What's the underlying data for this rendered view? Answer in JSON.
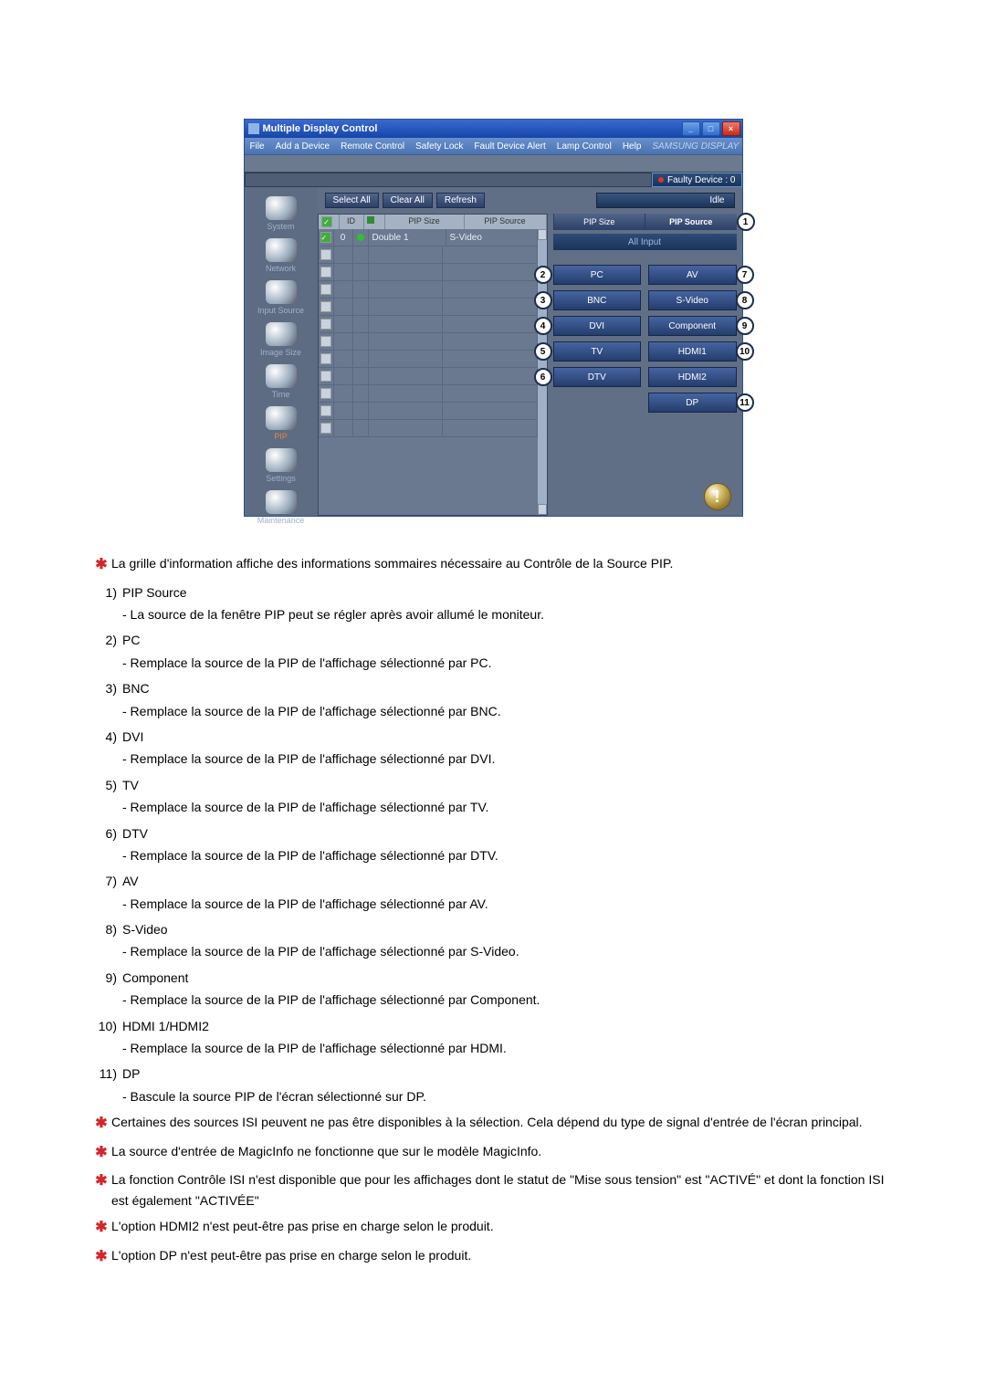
{
  "window": {
    "title": "Multiple Display Control",
    "menu": {
      "file": "File",
      "add_device": "Add a Device",
      "remote_control": "Remote Control",
      "safety_lock": "Safety Lock",
      "fault_alert": "Fault Device Alert",
      "lamp_control": "Lamp Control",
      "help": "Help",
      "brand": "SAMSUNG DISPLAY"
    },
    "status": {
      "faulty_device": "Faulty Device : 0"
    },
    "buttons": {
      "select_all": "Select All",
      "clear_all": "Clear All",
      "refresh": "Refresh",
      "idle": "Idle"
    },
    "sidebar": [
      {
        "label": "System"
      },
      {
        "label": "Network"
      },
      {
        "label": "Input Source"
      },
      {
        "label": "Image Size"
      },
      {
        "label": "Time"
      },
      {
        "label": "PIP"
      },
      {
        "label": "Settings"
      },
      {
        "label": "Maintenance"
      }
    ],
    "grid": {
      "headers": {
        "chk": "✓",
        "id": "ID",
        "status": "",
        "size": "PIP Size",
        "source": "PIP Source"
      },
      "row0": {
        "id": "0",
        "size": "Double 1",
        "source": "S-Video"
      }
    },
    "right_panel": {
      "tab_size": "PIP Size",
      "tab_source": "PIP Source",
      "all_input": "All Input",
      "buttons": {
        "pc": "PC",
        "av": "AV",
        "bnc": "BNC",
        "svideo": "S-Video",
        "dvi": "DVI",
        "component": "Component",
        "tv": "TV",
        "hdmi1": "HDMI1",
        "dtv": "DTV",
        "hdmi2": "HDMI2",
        "dp": "DP"
      }
    }
  },
  "explain": {
    "intro": "La grille d'information affiche des informations sommaires nécessaire au Contrôle de la Source PIP.",
    "items": [
      {
        "num": "1)",
        "title": "PIP Source",
        "desc": "- La source de la fenêtre PIP peut se régler après avoir allumé le moniteur."
      },
      {
        "num": "2)",
        "title": "PC",
        "desc": "- Remplace la source de la PIP de l'affichage sélectionné par PC."
      },
      {
        "num": "3)",
        "title": "BNC",
        "desc": "- Remplace la source de la PIP de l'affichage sélectionné par BNC."
      },
      {
        "num": "4)",
        "title": "DVI",
        "desc": "- Remplace la source de la PIP de l'affichage sélectionné par DVI."
      },
      {
        "num": "5)",
        "title": "TV",
        "desc": "- Remplace la source de la PIP de l'affichage sélectionné par TV."
      },
      {
        "num": "6)",
        "title": "DTV",
        "desc": "- Remplace la source de la PIP de l'affichage sélectionné par DTV."
      },
      {
        "num": "7)",
        "title": "AV",
        "desc": "- Remplace la source de la PIP de l'affichage sélectionné par AV."
      },
      {
        "num": "8)",
        "title": "S-Video",
        "desc": "- Remplace la source de la PIP de l'affichage sélectionné par S-Video."
      },
      {
        "num": "9)",
        "title": "Component",
        "desc": "- Remplace la source de la PIP de l'affichage sélectionné par Component."
      },
      {
        "num": "10)",
        "title": "HDMI 1/HDMI2",
        "desc": "- Remplace la source de la PIP de l'affichage sélectionné par HDMI."
      },
      {
        "num": "11)",
        "title": "DP",
        "desc": "- Bascule la source PIP de l'écran sélectionné sur DP."
      }
    ],
    "notes": [
      "Certaines des sources ISI peuvent ne pas être disponibles à la sélection. Cela dépend du type de signal d'entrée de l'écran principal.",
      "La source d'entrée de MagicInfo ne fonctionne que sur le modèle MagicInfo.",
      "La fonction Contrôle ISI n'est disponible que pour les affichages dont le statut de \"Mise sous tension\" est \"ACTIVÉ\" et dont la fonction ISI est également \"ACTIVÉE\"",
      "L'option HDMI2 n'est peut-être pas prise en charge selon le produit.",
      "L'option DP n'est peut-être pas prise en charge selon le produit."
    ]
  },
  "callouts": {
    "c1": "1",
    "c2": "2",
    "c3": "3",
    "c4": "4",
    "c5": "5",
    "c6": "6",
    "c7": "7",
    "c8": "8",
    "c9": "9",
    "c10": "10",
    "c11": "11"
  }
}
